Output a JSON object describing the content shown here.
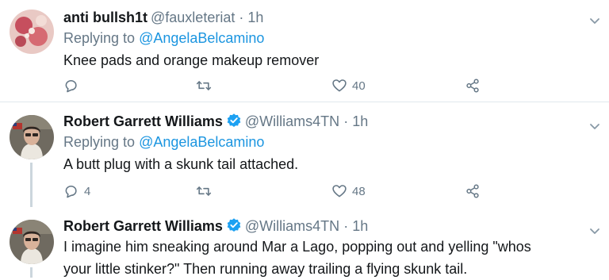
{
  "tweets": [
    {
      "name": "anti bullsh1t",
      "handle": "@fauxleteriat",
      "separator": "·",
      "time": "1h",
      "replying_prefix": "Replying to",
      "replying_to": "@AngelaBelcamino",
      "text": "Knee pads and orange makeup remover",
      "reply_count": "",
      "retweet_count": "",
      "like_count": "40"
    },
    {
      "name": "Robert Garrett Williams",
      "handle": "@Williams4TN",
      "separator": "·",
      "time": "1h",
      "replying_prefix": "Replying to",
      "replying_to": "@AngelaBelcamino",
      "text": "A butt plug with a skunk tail attached.",
      "reply_count": "4",
      "retweet_count": "",
      "like_count": "48"
    },
    {
      "name": "Robert Garrett Williams",
      "handle": "@Williams4TN",
      "separator": "·",
      "time": "1h",
      "text_line1": "I imagine him sneaking around Mar a Lago, popping out and yelling \"whos",
      "text_line2": "your little stinker?\" Then running away trailing a flying skunk tail."
    }
  ],
  "colors": {
    "text": "#14171a",
    "secondary": "#657786",
    "link": "#1b95e0",
    "verified": "#1da1f2",
    "divider": "#e1e8ed"
  },
  "icons": [
    "reply-icon",
    "retweet-icon",
    "like-icon",
    "share-icon",
    "verified-badge-icon",
    "chevron-down-icon"
  ]
}
